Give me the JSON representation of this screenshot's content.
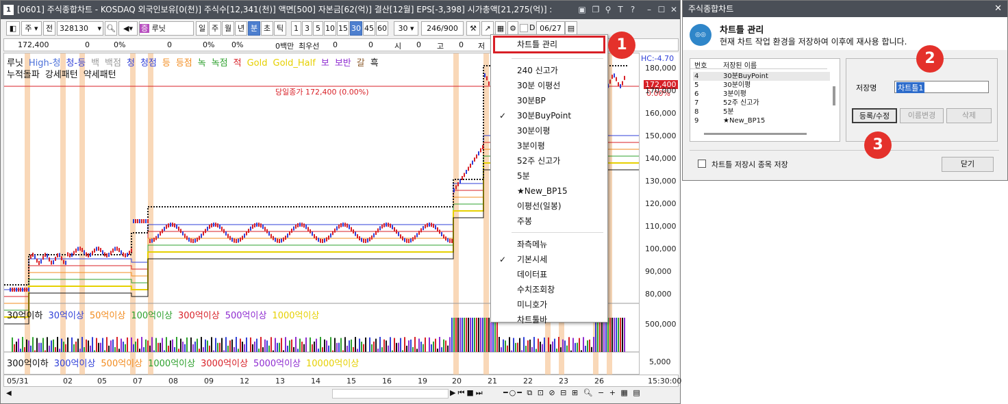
{
  "main": {
    "window_number": "1",
    "title": "[0601] 주식종합차트 - KOSDAQ 외국인보유[0(천)] 주식수[12,341(천)] 액면[500] 자본금[62(억)] 결산[12월] EPS[-3,398] 시가총액[21,275(억)] :",
    "toolbar": {
      "main_label": "주",
      "prev_label": "전",
      "code": "328130",
      "badge": "증",
      "name": "루닛",
      "periods": [
        "일",
        "주",
        "월",
        "년",
        "분",
        "초",
        "틱"
      ],
      "minutes": [
        "1",
        "3",
        "5",
        "10",
        "15",
        "30",
        "45",
        "60"
      ],
      "interval": "30",
      "count": "246",
      "total": "/900",
      "date_prefix": "D",
      "date": "06/27"
    },
    "info": [
      "172,400",
      "0",
      "0%",
      "0",
      "0%",
      "0%",
      "0백만",
      "최우선",
      "0",
      "0",
      "시",
      "0",
      "고",
      "0",
      "저"
    ],
    "legend_top": [
      "루닛",
      "High-청",
      "청-등",
      "백",
      "백점",
      "청",
      "청점",
      "등",
      "등점",
      "녹",
      "녹점",
      "적",
      "Gold",
      "Gold_Half",
      "보",
      "보반",
      "갈",
      "흑"
    ],
    "legend_top_colors": [
      "#111",
      "#4b6fd8",
      "#2f3fd8",
      "#999",
      "#999",
      "#2f3fd8",
      "#2f3fd8",
      "#f28b1e",
      "#f28b1e",
      "#2da02d",
      "#2da02d",
      "#d81f26",
      "#e6d000",
      "#e6d000",
      "#8e2bd0",
      "#8e2bd0",
      "#8b5a2b",
      "#111"
    ],
    "legend_second": [
      "누적돌파",
      "강세패턴",
      "약세패턴"
    ],
    "current_price_note": "당일종가 172,400 (0.00%)",
    "y_axis": [
      "180,000",
      "170,000",
      "160,000",
      "150,000",
      "140,000",
      "130,000",
      "120,000",
      "110,000",
      "100,000",
      "90,000",
      "80,000"
    ],
    "hc_label": "HC:-4.70",
    "last_price": "172,400",
    "last_pct": "0.00%",
    "vol_legend": [
      "30억이하",
      "30억이상",
      "50억이상",
      "100억이상",
      "300억이상",
      "500억이상",
      "1000억이상"
    ],
    "vol_legend_colors": [
      "#111",
      "#2f3fd8",
      "#f28b1e",
      "#2da02d",
      "#d81f26",
      "#8e2bd0",
      "#e6d000"
    ],
    "vol_axis": "500,000",
    "vol2_legend": [
      "300억이하",
      "300억이상",
      "500억이상",
      "1000억이상",
      "3000억이상",
      "5000억이상",
      "10000억이상"
    ],
    "vol2_axis": "5,000",
    "x_labels": [
      "05/31",
      "02",
      "05",
      "07",
      "08",
      "09",
      "12",
      "13",
      "14",
      "15",
      "16",
      "19",
      "20",
      "21",
      "22",
      "23",
      "26"
    ],
    "time_label": "15:30:00"
  },
  "menu": {
    "items": [
      {
        "label": "차트틀 관리",
        "checked": false
      },
      {
        "label": "240 신고가",
        "checked": false
      },
      {
        "label": "30분 이평선",
        "checked": false
      },
      {
        "label": "30분BP",
        "checked": false
      },
      {
        "label": "30분BuyPoint",
        "checked": true
      },
      {
        "label": "30분이평",
        "checked": false
      },
      {
        "label": "3분이평",
        "checked": false
      },
      {
        "label": "52주 신고가",
        "checked": false
      },
      {
        "label": "5분",
        "checked": false
      },
      {
        "label": "★New_BP15",
        "checked": false
      },
      {
        "label": "이평선(일봉)",
        "checked": false
      },
      {
        "label": "주봉",
        "checked": false
      },
      {
        "label": "좌측메뉴",
        "checked": false
      },
      {
        "label": "기본시세",
        "checked": true
      },
      {
        "label": "데이터표",
        "checked": false
      },
      {
        "label": "수치조회창",
        "checked": false
      },
      {
        "label": "미니호가",
        "checked": false
      },
      {
        "label": "차트툴바",
        "checked": false
      }
    ],
    "check_mark": "✓"
  },
  "dialog": {
    "title": "주식종합차트",
    "heading": "차트틀 관리",
    "description": "현재 차트 작업 환경을 저장하여 이후에 재사용 합니다.",
    "col_no": "번호",
    "col_name": "저장된 이름",
    "rows": [
      {
        "no": "4",
        "name": "30분BuyPoint"
      },
      {
        "no": "5",
        "name": "30분이평"
      },
      {
        "no": "6",
        "name": "3분이평"
      },
      {
        "no": "7",
        "name": "52주 신고가"
      },
      {
        "no": "8",
        "name": "5분"
      },
      {
        "no": "9",
        "name": "★New_BP15"
      }
    ],
    "save_label": "저장명",
    "save_value": "차트틀1",
    "btn_register": "등록/수정",
    "btn_rename": "이름변경",
    "btn_delete": "삭제",
    "checkbox_label": "차트틀 저장시 종목 저장",
    "btn_close": "닫기"
  },
  "badges": [
    "1",
    "2",
    "3"
  ]
}
